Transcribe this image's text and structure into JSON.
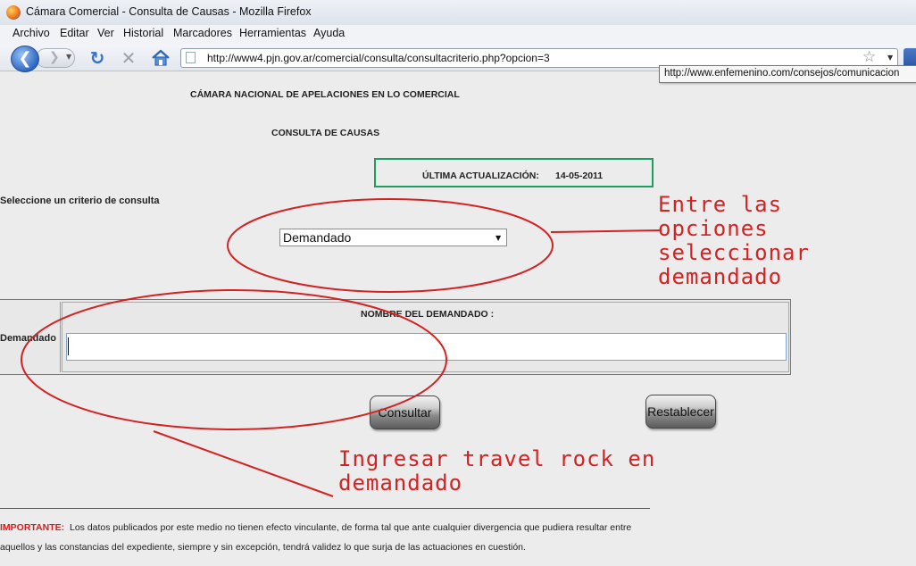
{
  "window": {
    "title": "Cámara Comercial - Consulta de Causas - Mozilla Firefox"
  },
  "menu": [
    {
      "label": "Archivo"
    },
    {
      "label": "Editar"
    },
    {
      "label": "Ver"
    },
    {
      "label": "Historial"
    },
    {
      "label": "Marcadores"
    },
    {
      "label": "Herramientas"
    },
    {
      "label": "Ayuda"
    }
  ],
  "navigation": {
    "url": "http://www4.pjn.gov.ar/comercial/consulta/consultacriterio.php?opcion=3",
    "tooltip": "http://www.enfemenino.com/consejos/comunicacion"
  },
  "page": {
    "heading": "CÁMARA NACIONAL DE APELACIONES EN LO COMERCIAL",
    "subheading": "CONSULTA DE CAUSAS",
    "update_label": "ÚLTIMA ACTUALIZACIÓN:",
    "update_date": "14-05-2011",
    "criteria_label": "Seleccione un criterio de consulta",
    "criteria_value": "Demandado",
    "row_label": "Demandado",
    "field_label": "NOMBRE DEL DEMANDADO :",
    "input_value": "",
    "consultar_label": "Consultar",
    "restablecer_label": "Restablecer",
    "note_label": "IMPORTANTE:",
    "note_line1": "Los datos publicados por este medio no tienen efecto vinculante, de forma tal que ante cualquier divergencia que pudiera resultar entre",
    "note_line2": "aquellos y las constancias del expediente, siempre y sin excepción, tendrá validez lo que surja de las actuaciones en cuestión."
  },
  "annotations": {
    "note1_lines": [
      "Entre las",
      "opciones",
      "seleccionar",
      "demandado"
    ],
    "note2_lines": [
      "Ingresar travel rock en",
      "demandado"
    ],
    "color": "#d42222"
  }
}
